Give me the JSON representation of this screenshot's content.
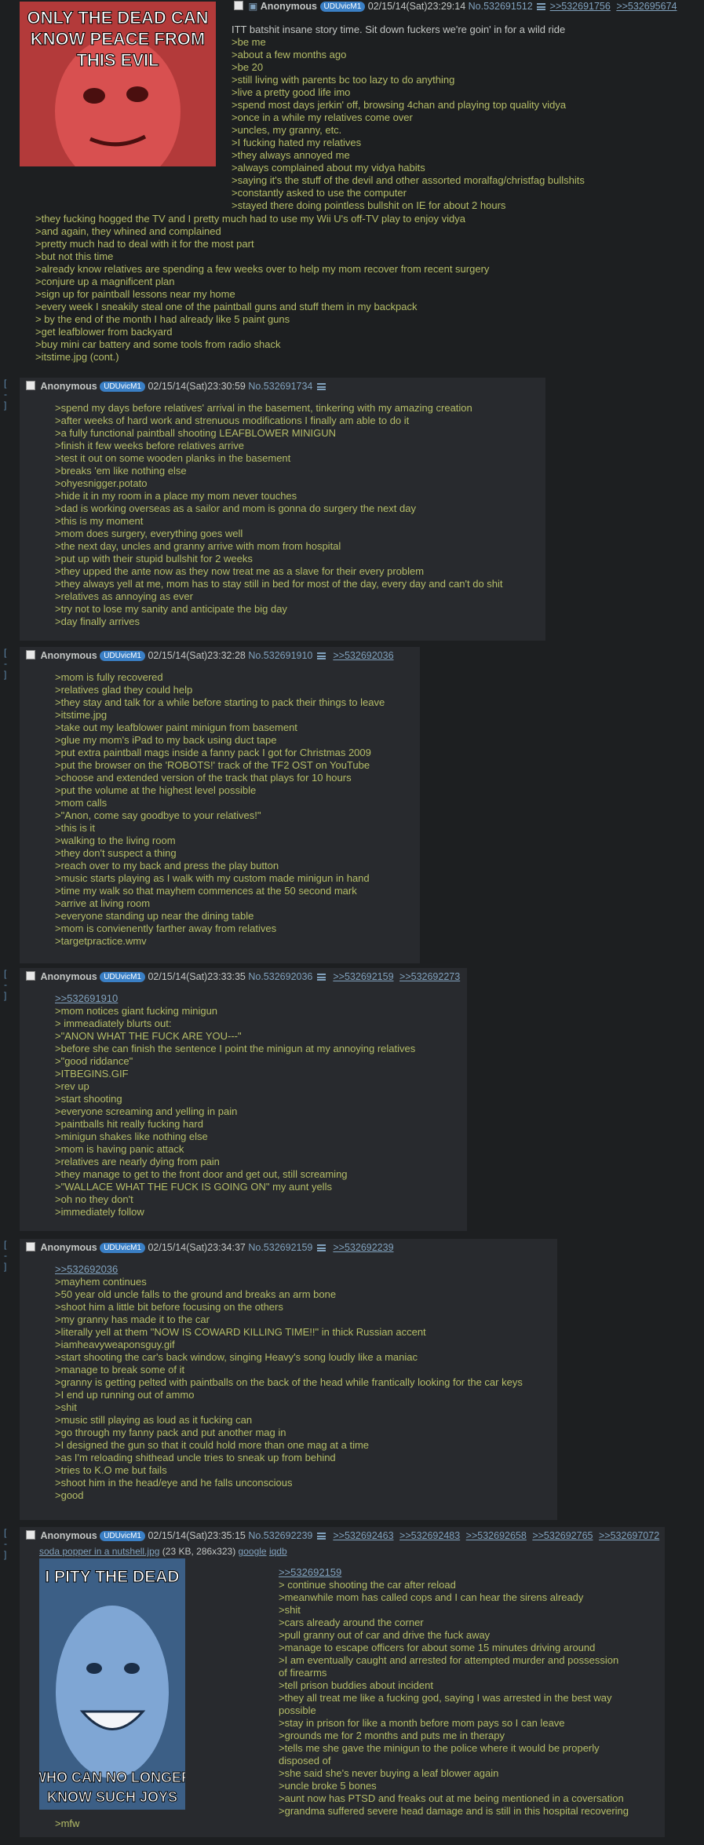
{
  "op": {
    "image_text_top": "ONLY THE DEAD CAN KNOW PEACE FROM THIS EVIL",
    "name": "Anonymous",
    "id": "UDUvicM1",
    "date": "02/15/14(Sat)23:29:14",
    "no": "No.532691512",
    "backlinks": [
      ">>532691756",
      ">>532695674"
    ],
    "lines": [
      "ITT batshit insane story time. Sit down fuckers we're goin' in for a wild ride",
      ">be me",
      ">about a few months ago",
      ">be 20",
      ">still living with parents bc too lazy to do anything",
      ">live a pretty good life imo",
      ">spend most days jerkin' off, browsing 4chan and playing top quality vidya",
      ">once in a while my relatives come over",
      ">uncles, my granny, etc.",
      ">I fucking hated my relatives",
      ">they always annoyed me",
      ">always complained about my vidya habits",
      ">saying it's the stuff of the devil and other assorted moralfag/christfag bullshits",
      ">constantly asked to use the computer",
      ">stayed there doing pointless bullshit on IE for about 2 hours"
    ],
    "lines_cont": [
      ">they fucking hogged the TV and I pretty much had to use my Wii U's off-TV play to enjoy vidya",
      ">and again, they whined and complained",
      ">pretty much had to deal with it for the most part",
      ">but not this time",
      ">already know relatives are spending a few weeks over to help my mom recover from recent surgery",
      ">conjure up a magnificent plan",
      ">sign up for paintball lessons near my home",
      ">every week I sneakily steal one of the paintball guns and stuff them in my backpack",
      "> by the end of the month I had already like 5 paint guns",
      ">get leafblower from backyard",
      ">buy mini car battery and some tools from radio shack",
      ">itstime.jpg (cont.)"
    ]
  },
  "replies": [
    {
      "name": "Anonymous",
      "id": "UDUvicM1",
      "date": "02/15/14(Sat)23:30:59",
      "no": "No.532691734",
      "backlinks": [],
      "lines": [
        ">spend my days before relatives' arrival in the basement, tinkering with my amazing creation",
        ">after weeks of hard work and strenuous modifications I finally am able to do it",
        ">a fully functional paintball shooting LEAFBLOWER MINIGUN",
        ">finish it few weeks before relatives arrive",
        ">test it out on some wooden planks in the basement",
        ">breaks 'em like nothing else",
        ">ohyesnigger.potato",
        ">hide it in my room in a place my mom never touches",
        ">dad is working overseas as a sailor and mom is gonna do surgery the next day",
        ">this is my moment",
        ">mom does surgery, everything goes well",
        ">the next day, uncles and granny arrive with mom from hospital",
        ">put up with their stupid bullshit for 2 weeks",
        ">they upped the ante now as they now treat me as a slave for their every problem",
        ">they always yell at me, mom has to stay still in bed for most of the day, every day and can't do shit",
        ">relatives as annoying as ever",
        ">try not to lose my sanity and anticipate the big day",
        ">day finally arrives"
      ]
    },
    {
      "name": "Anonymous",
      "id": "UDUvicM1",
      "date": "02/15/14(Sat)23:32:28",
      "no": "No.532691910",
      "backlinks": [
        ">>532692036"
      ],
      "lines": [
        ">mom is fully recovered",
        ">relatives glad they could help",
        ">they stay and talk for a while before starting to pack their things to leave",
        ">itstime.jpg",
        ">take out my leafblower paint minigun from basement",
        ">glue my mom's iPad to my back using duct tape",
        ">put extra paintball mags inside a fanny pack I got for Christmas 2009",
        ">put the browser on the 'ROBOTS!' track of the TF2 OST on YouTube",
        ">choose and extended version of the track that plays for 10 hours",
        ">put the volume at the highest level possible",
        ">mom calls",
        ">\"Anon, come say goodbye to your relatives!\"",
        ">this is it",
        ">walking to the living room",
        ">they don't suspect a thing",
        ">reach over to my back and press the play button",
        ">music starts playing as I walk with my custom made minigun in hand",
        ">time my walk so that mayhem commences at the 50 second mark",
        ">arrive at living room",
        ">everyone standing up near the dining table",
        ">mom is convienently farther away from relatives",
        ">targetpractice.wmv"
      ]
    },
    {
      "name": "Anonymous",
      "id": "UDUvicM1",
      "date": "02/15/14(Sat)23:33:35",
      "no": "No.532692036",
      "backlinks": [
        ">>532692159",
        ">>532692273"
      ],
      "quotelink": ">>532691910",
      "lines": [
        ">mom notices giant fucking minigun",
        "> immeadiately blurts out:",
        ">\"ANON WHAT THE FUCK ARE YOU---\"",
        ">before she can finish the sentence I point the minigun at my annoying relatives",
        ">\"good riddance\"",
        ">ITBEGINS.GIF",
        ">rev up",
        ">start shooting",
        ">everyone screaming and yelling in pain",
        ">paintballs hit really fucking hard",
        ">minigun shakes like nothing else",
        ">mom is having panic attack",
        ">relatives are nearly dying from pain",
        ">they manage to get to the front door and get out, still screaming",
        ">\"WALLACE WHAT THE FUCK IS GOING ON\" my aunt yells",
        ">oh no they don't",
        ">immediately follow"
      ]
    },
    {
      "name": "Anonymous",
      "id": "UDUvicM1",
      "date": "02/15/14(Sat)23:34:37",
      "no": "No.532692159",
      "backlinks": [
        ">>532692239"
      ],
      "quotelink": ">>532692036",
      "lines": [
        ">mayhem continues",
        ">50 year old uncle falls to the ground and breaks an arm bone",
        ">shoot him a little bit before focusing on the others",
        ">my granny has made it to the car",
        ">literally yell at them \"NOW IS COWARD KILLING TIME!!\" in thick Russian accent",
        ">iamheavyweaponsguy.gif",
        ">start shooting the car's back window, singing Heavy's song loudly like a maniac",
        ">manage to break some of it",
        ">granny is getting pelted with paintballs on the back of the head while frantically looking for the car keys",
        ">I end up running out of ammo",
        ">shit",
        ">music still playing as loud as it fucking can",
        ">go through my fanny pack and put another mag in",
        ">I designed the gun so that it could hold more than one mag at a time",
        ">as I'm reloading shithead uncle tries to sneak up from behind",
        ">tries to K.O me but fails",
        ">shoot him in the head/eye and he falls unconscious",
        ">good"
      ]
    },
    {
      "name": "Anonymous",
      "id": "UDUvicM1",
      "date": "02/15/14(Sat)23:35:15",
      "no": "No.532692239",
      "backlinks": [
        ">>532692463",
        ">>532692483",
        ">>532692658",
        ">>532692765",
        ">>532697072"
      ],
      "file_name": "soda popper in a nutshell.jpg",
      "file_meta": "(23 KB, 286x323)",
      "file_links": [
        "google",
        "iqdb"
      ],
      "image_text_top": "I PITY THE DEAD",
      "image_text_bottom": "WHO CAN NO LONGER KNOW SUCH JOYS",
      "quotelink": ">>532692159",
      "lines": [
        "> continue shooting the car after reload",
        ">meanwhile mom has called cops and I can hear the sirens already",
        ">shit",
        ">cars already around the corner",
        ">pull granny out of car and drive the fuck away",
        ">manage to escape officers for about some 15 minutes driving around",
        ">I am eventually caught and arrested for attempted murder and possession",
        "of firearms",
        ">tell prison buddies about incident",
        ">they all treat me like a fucking god, saying I was arrested in the best way",
        "possible",
        ">stay in prison for like a month before mom pays so I can leave",
        ">grounds me for 2 months and puts me in therapy",
        ">tells me she gave the minigun to the police where it would be properly",
        "disposed of",
        ">she said she's never buying a leaf blower again",
        ">uncle broke 5 bones",
        ">aunt now has PTSD and freaks out at me being mentioned in a coversation",
        ">grandma suffered severe head damage and is still in this hospital recovering"
      ],
      "trailing": ">mfw"
    }
  ],
  "side_toggle": "[ - ]"
}
